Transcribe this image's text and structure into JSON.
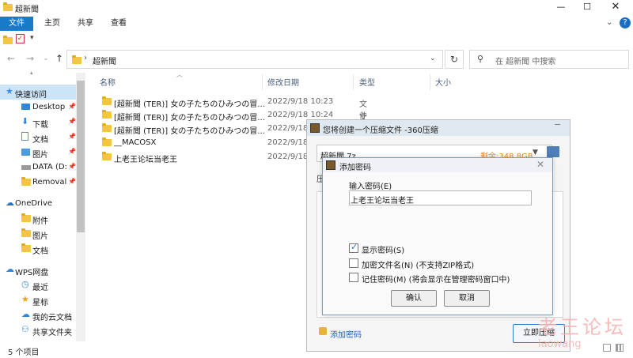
{
  "window": {
    "title": "超新聞"
  },
  "ribbon": {
    "tabs": [
      "文件",
      "主页",
      "共享",
      "查看"
    ]
  },
  "address": {
    "path": "超新聞",
    "search_placeholder": "在 超新聞 中搜索"
  },
  "nav": {
    "items": [
      {
        "label": "快速访问",
        "icon": "star-icon",
        "top": true
      },
      {
        "label": "Desktop",
        "icon": "desktop-icon",
        "pin": true
      },
      {
        "label": "下载",
        "icon": "download-icon",
        "pin": true
      },
      {
        "label": "文档",
        "icon": "document-icon",
        "pin": true
      },
      {
        "label": "图片",
        "icon": "picture-icon",
        "pin": true
      },
      {
        "label": "DATA (D:",
        "icon": "drive-icon",
        "pin": true
      },
      {
        "label": "Removal",
        "icon": "folder-icon",
        "pin": true
      },
      {
        "label": "OneDrive",
        "icon": "cloud-icon",
        "top": true
      },
      {
        "label": "附件",
        "icon": "folder-icon"
      },
      {
        "label": "图片",
        "icon": "folder-icon"
      },
      {
        "label": "文档",
        "icon": "folder-icon"
      },
      {
        "label": "WPS网盘",
        "icon": "cloud-icon",
        "top": true
      },
      {
        "label": "最近",
        "icon": "clock-icon"
      },
      {
        "label": "星标",
        "icon": "star-icon"
      },
      {
        "label": "我的云文档",
        "icon": "cloud-doc-icon"
      },
      {
        "label": "共享文件夹",
        "icon": "shared-icon"
      }
    ]
  },
  "columns": {
    "name": "名称",
    "date": "修改日期",
    "type": "类型",
    "size": "大小"
  },
  "files": [
    {
      "name": "[超新聞 (TER)] 女の子たちのひみつの冒...",
      "date": "2022/9/18 10:23",
      "type": "文件夹"
    },
    {
      "name": "[超新聞 (TER)] 女の子たちのひみつの冒...",
      "date": "2022/9/18 10:24",
      "type": "文件夹"
    },
    {
      "name": "[超新聞 (TER)] 女の子たちのひみつの冒...",
      "date": "2022/9/18",
      "type": ""
    },
    {
      "name": "__MACOSX",
      "date": "2022/9/18",
      "type": ""
    },
    {
      "name": "上老王论坛当老王",
      "date": "2022/9/18",
      "type": ""
    }
  ],
  "status": {
    "count": "5 个项目"
  },
  "compress_dialog": {
    "title": "您将创建一个压缩文件 -360压缩",
    "filename": "超新聞.7z",
    "remaining": "剩余:348.8GB",
    "label_partial": "压",
    "add_password_link": "添加密码",
    "compress_button": "立即压缩"
  },
  "password_dialog": {
    "title": "添加密码",
    "input_label": "输入密码(E)",
    "password_value": "上老王论坛当老王",
    "options": [
      {
        "label": "显示密码(S)",
        "checked": true
      },
      {
        "label": "加密文件名(N) (不支持ZIP格式)",
        "checked": false
      },
      {
        "label": "记住密码(M) (将会显示在管理密码窗口中)",
        "checked": false
      }
    ],
    "ok": "确认",
    "cancel": "取消"
  },
  "watermark": {
    "line1": "老王论坛",
    "line2": "laowang"
  }
}
